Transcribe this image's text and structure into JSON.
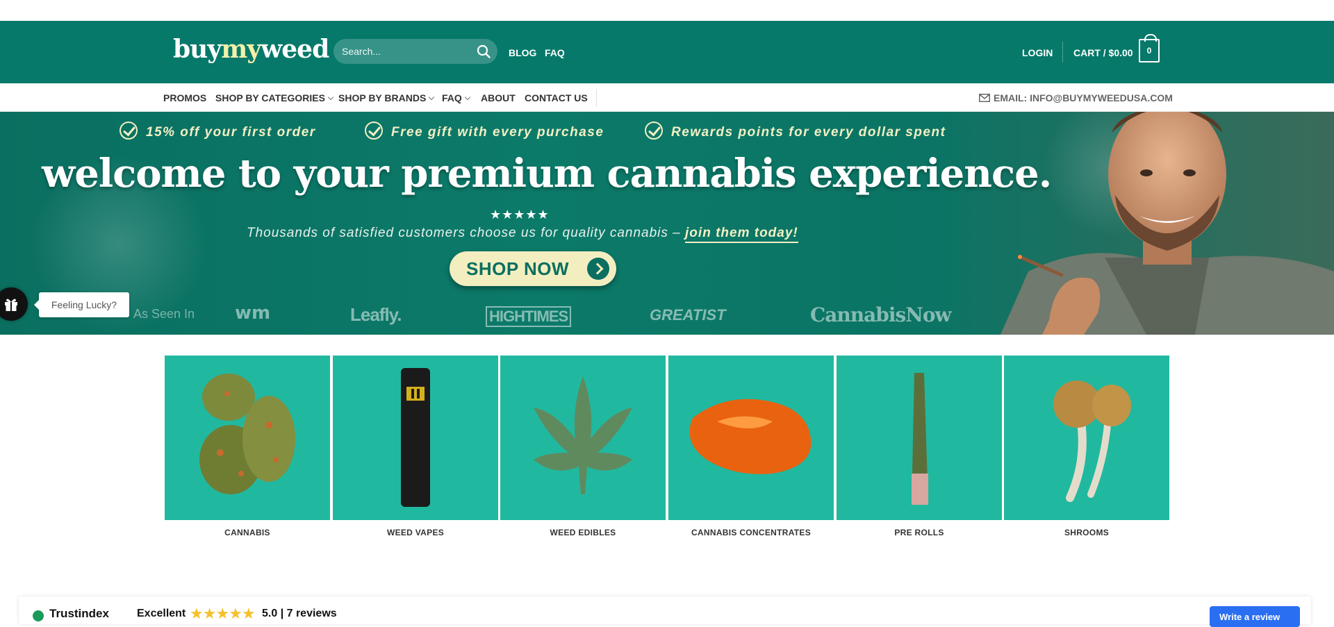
{
  "header": {
    "logo": {
      "part1": "buy",
      "part2": "my",
      "part3": "weed"
    },
    "search": {
      "placeholder": "Search..."
    },
    "links": {
      "blog": "BLOG",
      "faq": "FAQ",
      "login": "LOGIN"
    },
    "cart": {
      "label": "CART / $0.00",
      "count": "0"
    }
  },
  "nav": {
    "items": [
      {
        "label": "PROMOS"
      },
      {
        "label": "SHOP BY CATEGORIES"
      },
      {
        "label": "SHOP BY BRANDS"
      },
      {
        "label": "FAQ"
      },
      {
        "label": "ABOUT"
      },
      {
        "label": "CONTACT US"
      }
    ],
    "email": "EMAIL: INFO@BUYMYWEEDUSA.COM"
  },
  "hero": {
    "perks": [
      "15% off your first order",
      "Free gift with every purchase",
      "Rewards points for every dollar spent"
    ],
    "title": "welcome to your premium cannabis experience.",
    "stars": "★★★★★",
    "tagline": "Thousands of satisfied customers choose us for quality cannabis – ",
    "tagline_cta": "join them today!",
    "button": "SHOP NOW",
    "seen_in": "As Seen In",
    "press": [
      "wm",
      "Leafly.",
      "HIGHTIMES",
      "GREATIST",
      "CannabisNow"
    ]
  },
  "lucky": {
    "label": "Feeling Lucky?"
  },
  "categories": [
    {
      "label": "CANNABIS"
    },
    {
      "label": "WEED VAPES"
    },
    {
      "label": "WEED EDIBLES"
    },
    {
      "label": "CANNABIS CONCENTRATES"
    },
    {
      "label": "PRE ROLLS"
    },
    {
      "label": "SHROOMS"
    }
  ],
  "trustindex": {
    "name": "Trustindex",
    "rating": "Excellent",
    "stars": "★★★★★",
    "score": "5.0 | 7 reviews",
    "button": "Write a review"
  },
  "colors": {
    "brand": "#06796a",
    "accent": "#f3eec0",
    "tile": "#21b8a0"
  }
}
